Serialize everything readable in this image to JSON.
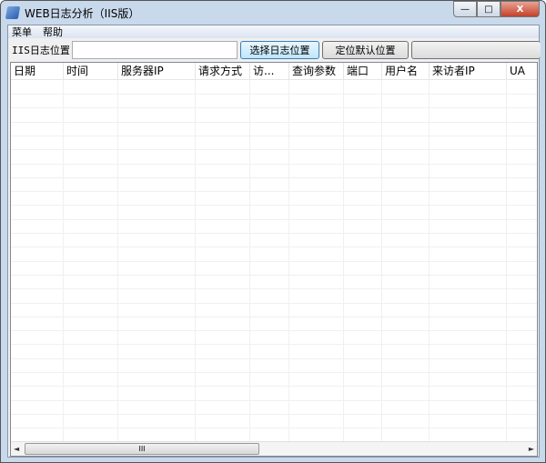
{
  "window": {
    "title": "WEB日志分析（IIS版）",
    "minimize": "—",
    "maximize": "□",
    "close": "X"
  },
  "menu": [
    {
      "label": "菜单"
    },
    {
      "label": "帮助"
    }
  ],
  "toolbar": {
    "path_label": "IIS日志位置:",
    "path_value": "",
    "select_button": "选择日志位置",
    "locate_button": "定位默认位置"
  },
  "table": {
    "columns": [
      "日期",
      "时间",
      "服务器IP",
      "请求方式",
      "访...",
      "查询参数",
      "端口",
      "用户名",
      "来访者IP",
      "UA"
    ],
    "rows": []
  },
  "scrollbar": {
    "thumb_grip": "III",
    "left": "◄",
    "right": "►"
  }
}
